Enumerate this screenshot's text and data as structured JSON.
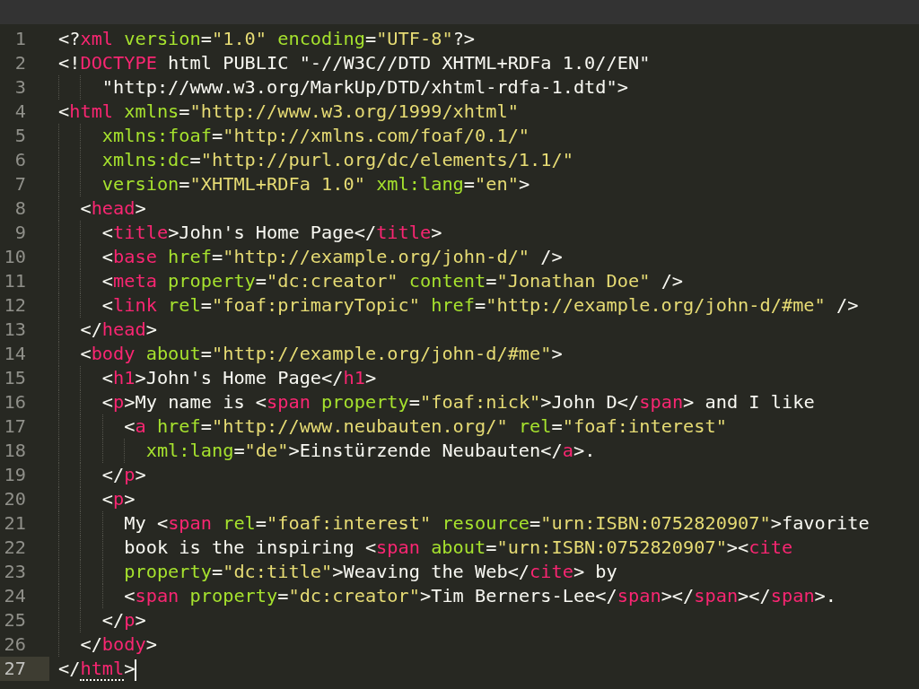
{
  "editor": {
    "lines": [
      {
        "number": "1",
        "current": false,
        "tokens": [
          {
            "kind": "punct",
            "text": "<?"
          },
          {
            "kind": "tag",
            "text": "xml"
          },
          {
            "kind": "attr",
            "text": " version"
          },
          {
            "kind": "punct",
            "text": "="
          },
          {
            "kind": "string",
            "text": "\"1.0\""
          },
          {
            "kind": "attr",
            "text": " encoding"
          },
          {
            "kind": "punct",
            "text": "="
          },
          {
            "kind": "string",
            "text": "\"UTF-8\""
          },
          {
            "kind": "punct",
            "text": "?>"
          }
        ]
      },
      {
        "number": "2",
        "current": false,
        "tokens": [
          {
            "kind": "punct",
            "text": "<!"
          },
          {
            "kind": "tag",
            "text": "DOCTYPE"
          },
          {
            "kind": "text",
            "text": " html PUBLIC \"-//W3C//DTD XHTML+RDFa 1.0//EN\""
          }
        ]
      },
      {
        "number": "3",
        "current": false,
        "tokens": [
          {
            "kind": "text",
            "text": "    \"http://www.w3.org/MarkUp/DTD/xhtml-rdfa-1.dtd\">"
          }
        ]
      },
      {
        "number": "4",
        "current": false,
        "tokens": [
          {
            "kind": "punct",
            "text": "<"
          },
          {
            "kind": "tag",
            "text": "html"
          },
          {
            "kind": "attr",
            "text": " xmlns"
          },
          {
            "kind": "punct",
            "text": "="
          },
          {
            "kind": "string",
            "text": "\"http://www.w3.org/1999/xhtml\""
          }
        ]
      },
      {
        "number": "5",
        "current": false,
        "tokens": [
          {
            "kind": "attr",
            "text": "    xmlns:foaf"
          },
          {
            "kind": "punct",
            "text": "="
          },
          {
            "kind": "string",
            "text": "\"http://xmlns.com/foaf/0.1/\""
          }
        ]
      },
      {
        "number": "6",
        "current": false,
        "tokens": [
          {
            "kind": "attr",
            "text": "    xmlns:dc"
          },
          {
            "kind": "punct",
            "text": "="
          },
          {
            "kind": "string",
            "text": "\"http://purl.org/dc/elements/1.1/\""
          }
        ]
      },
      {
        "number": "7",
        "current": false,
        "tokens": [
          {
            "kind": "attr",
            "text": "    version"
          },
          {
            "kind": "punct",
            "text": "="
          },
          {
            "kind": "string",
            "text": "\"XHTML+RDFa 1.0\""
          },
          {
            "kind": "attr",
            "text": " xml:lang"
          },
          {
            "kind": "punct",
            "text": "="
          },
          {
            "kind": "string",
            "text": "\"en\""
          },
          {
            "kind": "punct",
            "text": ">"
          }
        ]
      },
      {
        "number": "8",
        "current": false,
        "tokens": [
          {
            "kind": "punct",
            "text": "  <"
          },
          {
            "kind": "tag",
            "text": "head"
          },
          {
            "kind": "punct",
            "text": ">"
          }
        ]
      },
      {
        "number": "9",
        "current": false,
        "tokens": [
          {
            "kind": "punct",
            "text": "    <"
          },
          {
            "kind": "tag",
            "text": "title"
          },
          {
            "kind": "punct",
            "text": ">"
          },
          {
            "kind": "text",
            "text": "John's Home Page"
          },
          {
            "kind": "punct",
            "text": "</"
          },
          {
            "kind": "tag",
            "text": "title"
          },
          {
            "kind": "punct",
            "text": ">"
          }
        ]
      },
      {
        "number": "10",
        "current": false,
        "tokens": [
          {
            "kind": "punct",
            "text": "    <"
          },
          {
            "kind": "tag",
            "text": "base"
          },
          {
            "kind": "attr",
            "text": " href"
          },
          {
            "kind": "punct",
            "text": "="
          },
          {
            "kind": "string",
            "text": "\"http://example.org/john-d/\""
          },
          {
            "kind": "punct",
            "text": " />"
          }
        ]
      },
      {
        "number": "11",
        "current": false,
        "tokens": [
          {
            "kind": "punct",
            "text": "    <"
          },
          {
            "kind": "tag",
            "text": "meta"
          },
          {
            "kind": "attr",
            "text": " property"
          },
          {
            "kind": "punct",
            "text": "="
          },
          {
            "kind": "string",
            "text": "\"dc:creator\""
          },
          {
            "kind": "attr",
            "text": " content"
          },
          {
            "kind": "punct",
            "text": "="
          },
          {
            "kind": "string",
            "text": "\"Jonathan Doe\""
          },
          {
            "kind": "punct",
            "text": " />"
          }
        ]
      },
      {
        "number": "12",
        "current": false,
        "tokens": [
          {
            "kind": "punct",
            "text": "    <"
          },
          {
            "kind": "tag",
            "text": "link"
          },
          {
            "kind": "attr",
            "text": " rel"
          },
          {
            "kind": "punct",
            "text": "="
          },
          {
            "kind": "string",
            "text": "\"foaf:primaryTopic\""
          },
          {
            "kind": "attr",
            "text": " href"
          },
          {
            "kind": "punct",
            "text": "="
          },
          {
            "kind": "string",
            "text": "\"http://example.org/john-d/#me\""
          },
          {
            "kind": "punct",
            "text": " />"
          }
        ]
      },
      {
        "number": "13",
        "current": false,
        "tokens": [
          {
            "kind": "punct",
            "text": "  </"
          },
          {
            "kind": "tag",
            "text": "head"
          },
          {
            "kind": "punct",
            "text": ">"
          }
        ]
      },
      {
        "number": "14",
        "current": false,
        "tokens": [
          {
            "kind": "punct",
            "text": "  <"
          },
          {
            "kind": "tag",
            "text": "body"
          },
          {
            "kind": "attr",
            "text": " about"
          },
          {
            "kind": "punct",
            "text": "="
          },
          {
            "kind": "string",
            "text": "\"http://example.org/john-d/#me\""
          },
          {
            "kind": "punct",
            "text": ">"
          }
        ]
      },
      {
        "number": "15",
        "current": false,
        "tokens": [
          {
            "kind": "punct",
            "text": "    <"
          },
          {
            "kind": "tag",
            "text": "h1"
          },
          {
            "kind": "punct",
            "text": ">"
          },
          {
            "kind": "text",
            "text": "John's Home Page"
          },
          {
            "kind": "punct",
            "text": "</"
          },
          {
            "kind": "tag",
            "text": "h1"
          },
          {
            "kind": "punct",
            "text": ">"
          }
        ]
      },
      {
        "number": "16",
        "current": false,
        "tokens": [
          {
            "kind": "punct",
            "text": "    <"
          },
          {
            "kind": "tag",
            "text": "p"
          },
          {
            "kind": "punct",
            "text": ">"
          },
          {
            "kind": "text",
            "text": "My name is "
          },
          {
            "kind": "punct",
            "text": "<"
          },
          {
            "kind": "tag",
            "text": "span"
          },
          {
            "kind": "attr",
            "text": " property"
          },
          {
            "kind": "punct",
            "text": "="
          },
          {
            "kind": "string",
            "text": "\"foaf:nick\""
          },
          {
            "kind": "punct",
            "text": ">"
          },
          {
            "kind": "text",
            "text": "John D"
          },
          {
            "kind": "punct",
            "text": "</"
          },
          {
            "kind": "tag",
            "text": "span"
          },
          {
            "kind": "punct",
            "text": ">"
          },
          {
            "kind": "text",
            "text": " and I like"
          }
        ]
      },
      {
        "number": "17",
        "current": false,
        "tokens": [
          {
            "kind": "punct",
            "text": "      <"
          },
          {
            "kind": "tag",
            "text": "a"
          },
          {
            "kind": "attr",
            "text": " href"
          },
          {
            "kind": "punct",
            "text": "="
          },
          {
            "kind": "string",
            "text": "\"http://www.neubauten.org/\""
          },
          {
            "kind": "attr",
            "text": " rel"
          },
          {
            "kind": "punct",
            "text": "="
          },
          {
            "kind": "string",
            "text": "\"foaf:interest\""
          }
        ]
      },
      {
        "number": "18",
        "current": false,
        "tokens": [
          {
            "kind": "attr",
            "text": "        xml:lang"
          },
          {
            "kind": "punct",
            "text": "="
          },
          {
            "kind": "string",
            "text": "\"de\""
          },
          {
            "kind": "punct",
            "text": ">"
          },
          {
            "kind": "text",
            "text": "Einstürzende Neubauten"
          },
          {
            "kind": "punct",
            "text": "</"
          },
          {
            "kind": "tag",
            "text": "a"
          },
          {
            "kind": "punct",
            "text": ">."
          }
        ]
      },
      {
        "number": "19",
        "current": false,
        "tokens": [
          {
            "kind": "punct",
            "text": "    </"
          },
          {
            "kind": "tag",
            "text": "p"
          },
          {
            "kind": "punct",
            "text": ">"
          }
        ]
      },
      {
        "number": "20",
        "current": false,
        "tokens": [
          {
            "kind": "punct",
            "text": "    <"
          },
          {
            "kind": "tag",
            "text": "p"
          },
          {
            "kind": "punct",
            "text": ">"
          }
        ]
      },
      {
        "number": "21",
        "current": false,
        "tokens": [
          {
            "kind": "text",
            "text": "      My "
          },
          {
            "kind": "punct",
            "text": "<"
          },
          {
            "kind": "tag",
            "text": "span"
          },
          {
            "kind": "attr",
            "text": " rel"
          },
          {
            "kind": "punct",
            "text": "="
          },
          {
            "kind": "string",
            "text": "\"foaf:interest\""
          },
          {
            "kind": "attr",
            "text": " resource"
          },
          {
            "kind": "punct",
            "text": "="
          },
          {
            "kind": "string",
            "text": "\"urn:ISBN:0752820907\""
          },
          {
            "kind": "punct",
            "text": ">"
          },
          {
            "kind": "text",
            "text": "favorite"
          }
        ]
      },
      {
        "number": "22",
        "current": false,
        "tokens": [
          {
            "kind": "text",
            "text": "      book is the inspiring "
          },
          {
            "kind": "punct",
            "text": "<"
          },
          {
            "kind": "tag",
            "text": "span"
          },
          {
            "kind": "attr",
            "text": " about"
          },
          {
            "kind": "punct",
            "text": "="
          },
          {
            "kind": "string",
            "text": "\"urn:ISBN:0752820907\""
          },
          {
            "kind": "punct",
            "text": "><"
          },
          {
            "kind": "tag",
            "text": "cite"
          }
        ]
      },
      {
        "number": "23",
        "current": false,
        "tokens": [
          {
            "kind": "attr",
            "text": "      property"
          },
          {
            "kind": "punct",
            "text": "="
          },
          {
            "kind": "string",
            "text": "\"dc:title\""
          },
          {
            "kind": "punct",
            "text": ">"
          },
          {
            "kind": "text",
            "text": "Weaving the Web"
          },
          {
            "kind": "punct",
            "text": "</"
          },
          {
            "kind": "tag",
            "text": "cite"
          },
          {
            "kind": "punct",
            "text": "> by"
          }
        ]
      },
      {
        "number": "24",
        "current": false,
        "tokens": [
          {
            "kind": "punct",
            "text": "      <"
          },
          {
            "kind": "tag",
            "text": "span"
          },
          {
            "kind": "attr",
            "text": " property"
          },
          {
            "kind": "punct",
            "text": "="
          },
          {
            "kind": "string",
            "text": "\"dc:creator\""
          },
          {
            "kind": "punct",
            "text": ">"
          },
          {
            "kind": "text",
            "text": "Tim Berners-Lee"
          },
          {
            "kind": "punct",
            "text": "</"
          },
          {
            "kind": "tag",
            "text": "span"
          },
          {
            "kind": "punct",
            "text": "></"
          },
          {
            "kind": "tag",
            "text": "span"
          },
          {
            "kind": "punct",
            "text": "></"
          },
          {
            "kind": "tag",
            "text": "span"
          },
          {
            "kind": "punct",
            "text": ">."
          }
        ]
      },
      {
        "number": "25",
        "current": false,
        "tokens": [
          {
            "kind": "punct",
            "text": "    </"
          },
          {
            "kind": "tag",
            "text": "p"
          },
          {
            "kind": "punct",
            "text": ">"
          }
        ]
      },
      {
        "number": "26",
        "current": false,
        "tokens": [
          {
            "kind": "punct",
            "text": "  </"
          },
          {
            "kind": "tag",
            "text": "body"
          },
          {
            "kind": "punct",
            "text": ">"
          }
        ]
      },
      {
        "number": "27",
        "current": true,
        "tokens": [
          {
            "kind": "punct",
            "text": "</"
          },
          {
            "kind": "tag",
            "text": "html",
            "matched": true
          },
          {
            "kind": "punct",
            "text": ">"
          }
        ]
      }
    ]
  }
}
